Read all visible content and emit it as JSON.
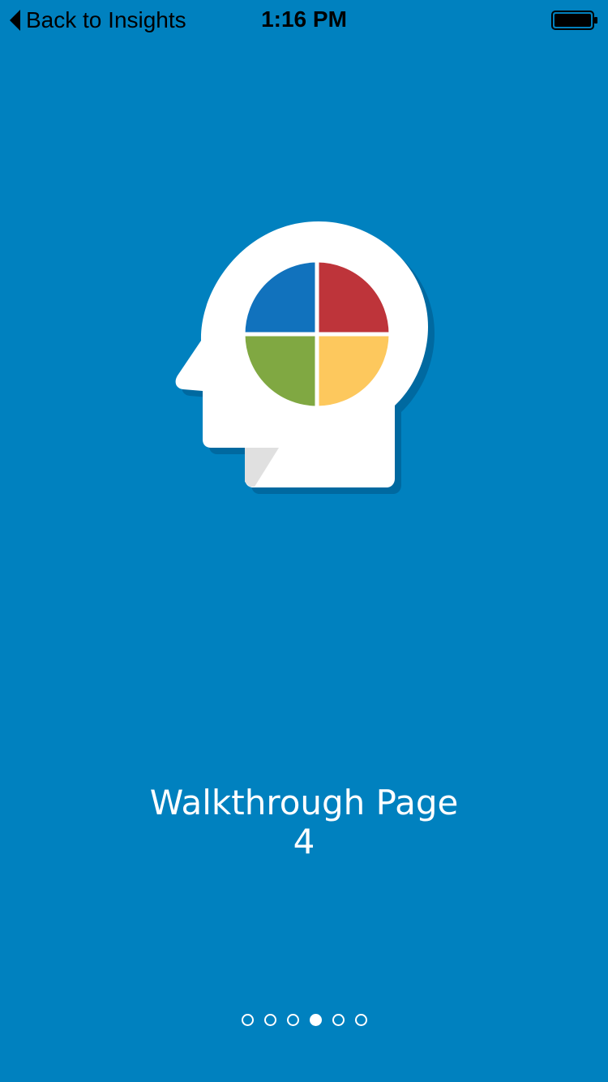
{
  "status_bar": {
    "back_label": "Back to Insights",
    "time": "1:16 PM",
    "battery_icon": "battery-full-icon"
  },
  "illustration": {
    "icon": "head-with-pie-chart-icon",
    "colors": {
      "background": "#0081bf",
      "head": "#ffffff",
      "shadow": "#0069a0",
      "quadrant_top_left": "#1172bd",
      "quadrant_top_right": "#be343a",
      "quadrant_bottom_left": "#80a842",
      "quadrant_bottom_right": "#fdc85d"
    }
  },
  "page": {
    "title_line1": "Walkthrough Page",
    "title_line2": "4"
  },
  "pagination": {
    "total": 6,
    "active_index": 3
  }
}
